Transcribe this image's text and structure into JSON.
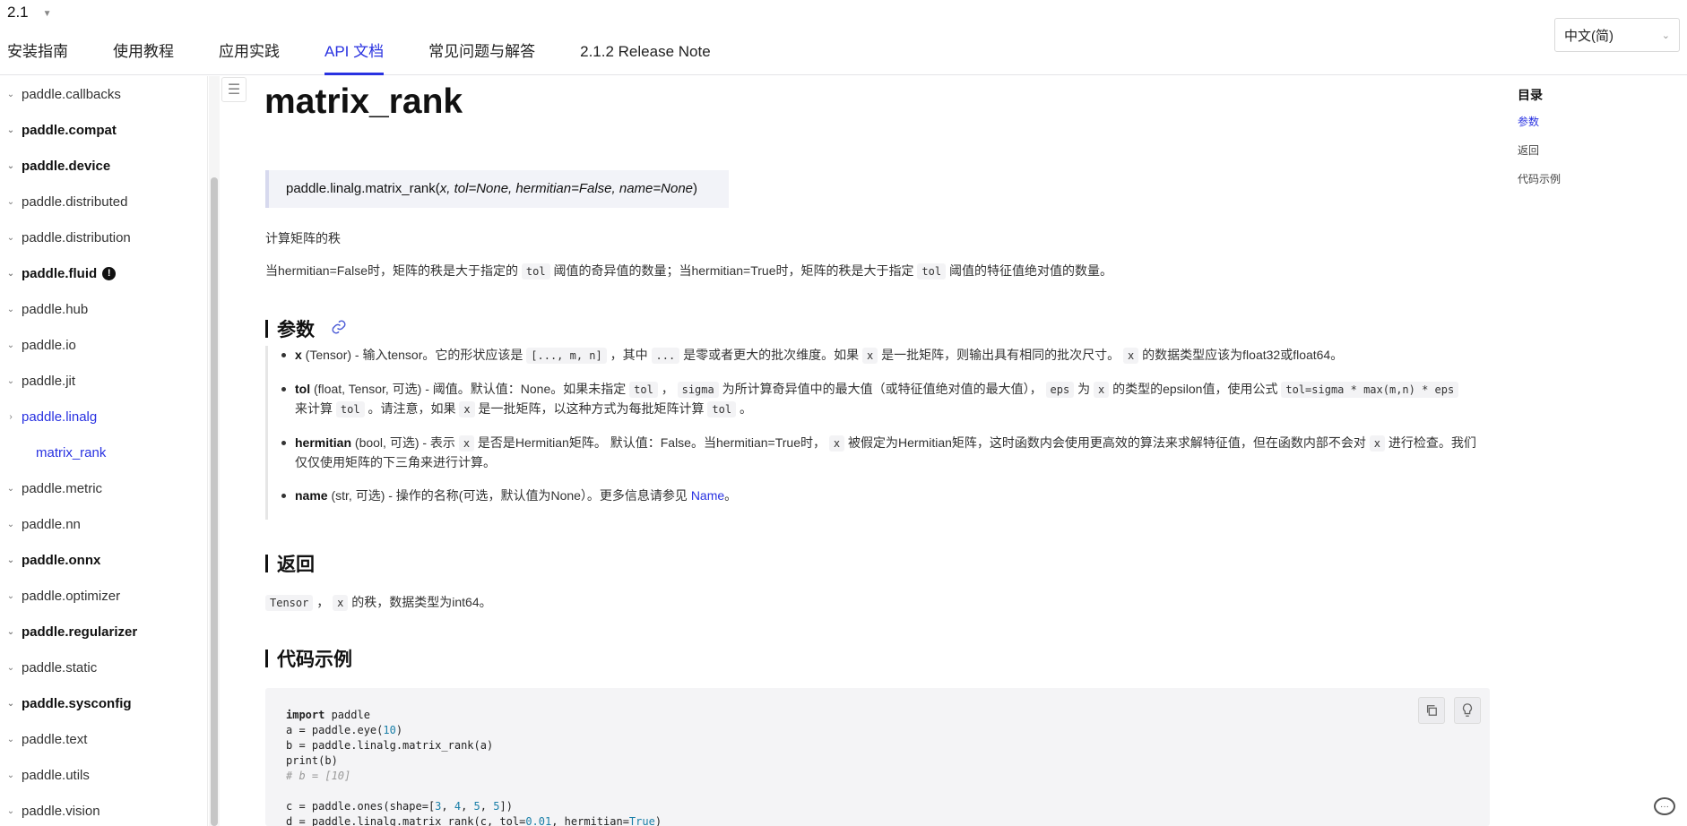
{
  "header": {
    "version": "2.1",
    "nav": [
      "安装指南",
      "使用教程",
      "应用实践",
      "API 文档",
      "常见问题与解答",
      "2.1.2 Release Note"
    ],
    "active_nav": "API 文档",
    "language": "中文(简)"
  },
  "sidebar": {
    "items": [
      {
        "label": "paddle.callbacks"
      },
      {
        "label": "paddle.compat"
      },
      {
        "label": "paddle.device"
      },
      {
        "label": "paddle.distributed"
      },
      {
        "label": "paddle.distribution"
      },
      {
        "label": "paddle.fluid",
        "badge": "!"
      },
      {
        "label": "paddle.hub"
      },
      {
        "label": "paddle.io"
      },
      {
        "label": "paddle.jit"
      },
      {
        "label": "paddle.linalg"
      },
      {
        "label": "matrix_rank"
      },
      {
        "label": "paddle.metric"
      },
      {
        "label": "paddle.nn"
      },
      {
        "label": "paddle.onnx"
      },
      {
        "label": "paddle.optimizer"
      },
      {
        "label": "paddle.regularizer"
      },
      {
        "label": "paddle.static"
      },
      {
        "label": "paddle.sysconfig"
      },
      {
        "label": "paddle.text"
      },
      {
        "label": "paddle.utils"
      },
      {
        "label": "paddle.vision"
      }
    ]
  },
  "main": {
    "title": "matrix_rank",
    "signature": {
      "prefix": "paddle.linalg.matrix_rank(",
      "args": "x, tol=None, hermitian=False, name=None",
      "suffix": ")"
    },
    "summary": "计算矩阵的秩",
    "description": {
      "p1": "当hermitian=False时，矩阵的秩是大于指定的",
      "code1": "tol",
      "p2": "阈值的奇异值的数量；当hermitian=True时，矩阵的秩是大于指定",
      "code2": "tol",
      "p3": "阈值的特征值绝对值的数量。"
    },
    "params_heading": "参数",
    "params": {
      "x": {
        "name": "x",
        "t1": " (Tensor) - 输入tensor。它的形状应该是 ",
        "c1": "[..., m, n]",
        "t2": " ，其中 ",
        "c2": "...",
        "t3": " 是零或者更大的批次维度。如果 ",
        "c3": "x",
        "t4": " 是一批矩阵，则输出具有相同的批次尺寸。 ",
        "c4": "x",
        "t5": " 的数据类型应该为float32或float64。"
      },
      "tol": {
        "name": "tol",
        "t1": " (float, Tensor, 可选) - 阈值。默认值：None。如果未指定 ",
        "c1": "tol",
        "t2": " ， ",
        "c2": "sigma",
        "t3": " 为所计算奇异值中的最大值（或特征值绝对值的最大值）， ",
        "c3": "eps",
        "t4": " 为 ",
        "c4": "x",
        "t5": " 的类型的epsilon值，使用公式 ",
        "c5": "tol=sigma * max(m,n) * eps",
        "t6": " 来计算 ",
        "c6": "tol",
        "t7": " 。请注意，如果 ",
        "c7": "x",
        "t8": " 是一批矩阵，以这种方式为每批矩阵计算 ",
        "c8": "tol",
        "t9": " 。"
      },
      "hermitian": {
        "name": "hermitian",
        "t1": " (bool, 可选) - 表示 ",
        "c1": "x",
        "t2": " 是否是Hermitian矩阵。 默认值：False。当hermitian=True时， ",
        "c2": "x",
        "t3": " 被假定为Hermitian矩阵，这时函数内会使用更高效的算法来求解特征值，但在函数内部不会对 ",
        "c3": "x",
        "t4": " 进行检查。我们仅仅使用矩阵的下三角来进行计算。"
      },
      "name": {
        "name": "name",
        "t1": " (str, 可选) - 操作的名称(可选，默认值为None）。更多信息请参见 ",
        "link": "Name",
        "t2": "。"
      }
    },
    "returns_heading": "返回",
    "returns": {
      "c1": "Tensor",
      "t1": " ， ",
      "c2": "x",
      "t2": " 的秩，数据类型为int64。"
    },
    "example_heading": "代码示例",
    "code": {
      "l1_kw": "import",
      "l1": " paddle",
      "l2a": "a = paddle.eye(",
      "l2n": "10",
      "l2b": ")",
      "l3": "b = paddle.linalg.matrix_rank(a)",
      "l4": "print(b)",
      "l5": "# b = [10]",
      "l7a": "c = paddle.ones(shape=[",
      "l7n1": "3",
      "l7s1": ", ",
      "l7n2": "4",
      "l7s2": ", ",
      "l7n3": "5",
      "l7s3": ", ",
      "l7n4": "5",
      "l7b": "])",
      "l8a": "d = paddle.linalg.matrix_rank(c, tol=",
      "l8n": "0.01",
      "l8b": ", hermitian=",
      "l8t": "True",
      "l8c": ")"
    }
  },
  "toc": {
    "title": "目录",
    "items": [
      "参数",
      "返回",
      "代码示例"
    ],
    "active": "参数"
  },
  "icons": {
    "version_caret": "caret-down-icon",
    "language_chevron": "chevron-down-icon",
    "toc_toggle": "list-icon",
    "anchor_link": "link-icon",
    "copy": "copy-icon",
    "hint": "lightbulb-icon",
    "feedback": "chat-icon"
  },
  "colors": {
    "accent": "#2932e1",
    "code_bg": "#f4f4f6"
  }
}
